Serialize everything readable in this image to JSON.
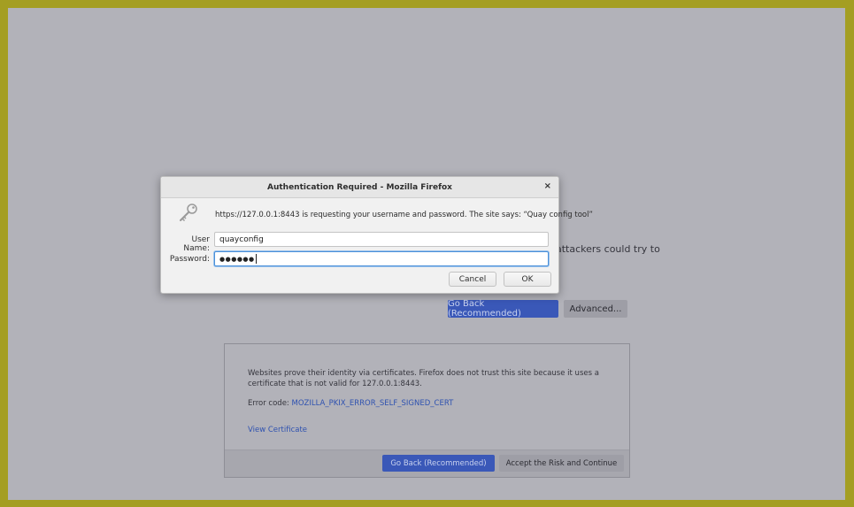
{
  "background": {
    "partial_line": "attackers could try to",
    "go_back_label": "Go Back (Recommended)",
    "advanced_label": "Advanced...",
    "panel": {
      "description": "Websites prove their identity via certificates. Firefox does not trust this site because it uses a certificate that is not valid for 127.0.0.1:8443.",
      "error_code_prefix": "Error code: ",
      "error_code": "MOZILLA_PKIX_ERROR_SELF_SIGNED_CERT",
      "view_certificate": "View Certificate",
      "go_back_label": "Go Back (Recommended)",
      "accept_label": "Accept the Risk and Continue"
    }
  },
  "dialog": {
    "title": "Authentication Required - Mozilla Firefox",
    "close_glyph": "×",
    "icon": "key-icon",
    "message": "https://127.0.0.1:8443 is requesting your username and password. The site says: “Quay config tool”",
    "username_label": "User Name:",
    "username_value": "quayconfig",
    "password_label": "Password:",
    "password_mask": "●●●●●●",
    "cancel_label": "Cancel",
    "ok_label": "OK"
  },
  "colors": {
    "outer_border": "#a49e22",
    "primary_button": "#3a58b8",
    "link": "#2f52b0"
  }
}
